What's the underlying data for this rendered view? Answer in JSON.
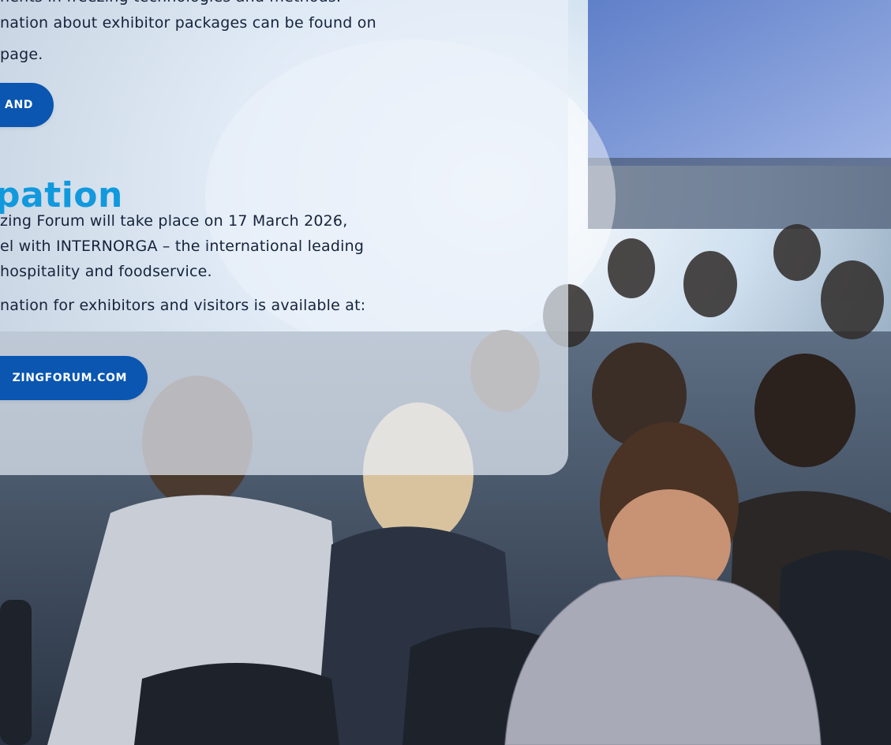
{
  "exhibitor_section": {
    "lines": [
      "nents in freezing technologies and methods.",
      "nation about exhibitor packages can be found on",
      "page."
    ],
    "button_label": "AND"
  },
  "participation_section": {
    "heading": "pation",
    "lines": [
      "zing Forum will take place on 17 March 2026,",
      "el with INTERNORGA – the international leading",
      "hospitality and foodservice.",
      "nation for exhibitors and visitors is available at:"
    ],
    "button_label": "ZINGFORUM.COM"
  },
  "colors": {
    "heading": "#1199dd",
    "button": "#0a56b0",
    "body_text": "#15233b",
    "panel": "#e8f0fa"
  }
}
